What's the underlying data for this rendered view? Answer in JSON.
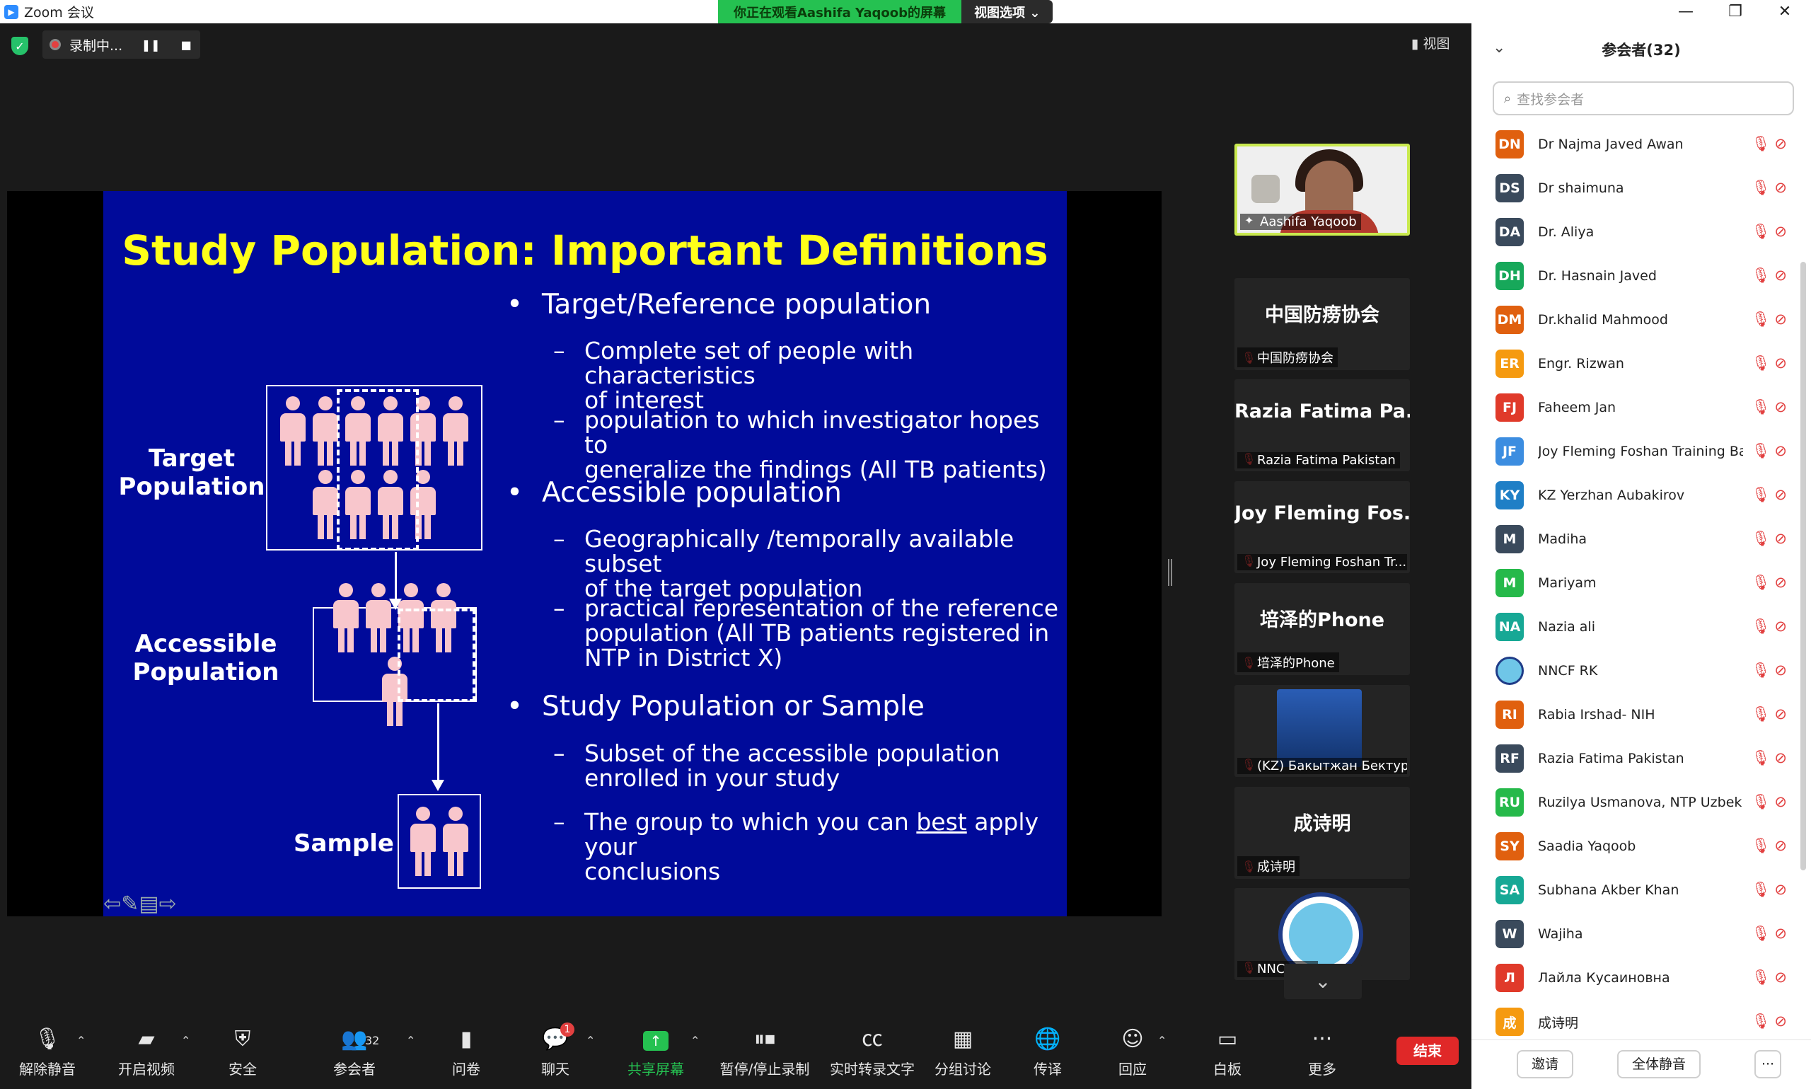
{
  "window": {
    "app_title": "Zoom 会议",
    "watching_banner": "你正在观看Aashifa Yaqoob的屏幕",
    "view_options": "视图选项 ⌄",
    "minimize": "—",
    "restore": "❐",
    "close": "✕"
  },
  "meeting": {
    "recording_label": "录制中...",
    "pause_glyph": "❚❚",
    "stop_glyph": "■",
    "view_button": "▮ 视图"
  },
  "slide": {
    "title": "Study Population: Important Definitions",
    "bullets": [
      {
        "text": "Target/Reference population",
        "subs": [
          "Complete set of people with characteristics of interest",
          "population to which investigator hopes to generalize the findings (All TB patients)"
        ]
      },
      {
        "text": "Accessible population",
        "subs": [
          "Geographically /temporally available subset of the target population",
          "practical representation of the reference population (All TB patients registered in NTP in District X)"
        ]
      },
      {
        "text": "Study Population or Sample",
        "subs": [
          "Subset of the accessible population enrolled in your study",
          "The group to which you can best apply your conclusions"
        ]
      }
    ],
    "sub_lines": {
      "b1s1": [
        "Complete set of people with characteristics",
        "of interest"
      ],
      "b1s2": [
        "population to which investigator hopes to",
        "generalize the findings (All TB patients)"
      ],
      "b2s1": [
        "Geographically /temporally available subset",
        "of the target population"
      ],
      "b2s2": [
        "practical representation of the reference",
        "population (All TB patients registered in",
        "NTP in District X)"
      ],
      "b3s1": [
        "Subset of the accessible population",
        "enrolled in your study"
      ],
      "b3s2_pre": "The group to which you can ",
      "b3s2_underlined": "best",
      "b3s2_post": " apply your",
      "b3s2_line2": "conclusions"
    },
    "diagram": {
      "target_label": [
        "Target",
        "Population"
      ],
      "accessible_label": [
        "Accessible",
        "Population"
      ],
      "sample_label": "Sample"
    },
    "bullet_glyph": "•",
    "dash_glyph": "–",
    "nav_glyphs": "⇦✎▤⇨"
  },
  "thumbnails": [
    {
      "big": "",
      "tag": "Aashifa Yaqoob",
      "type": "video"
    },
    {
      "big": "中国防痨协会",
      "tag": "中国防痨协会"
    },
    {
      "big": "Razia Fatima Pa...",
      "tag": "Razia Fatima Pakistan"
    },
    {
      "big": "Joy Fleming Fos...",
      "tag": "Joy Fleming Foshan Tr..."
    },
    {
      "big": "培泽的Phone",
      "tag": "培泽的Phone"
    },
    {
      "big": "",
      "tag": "(KZ) Бакытжан Бектур...",
      "type": "photo"
    },
    {
      "big": "成诗明",
      "tag": "成诗明"
    },
    {
      "big": "",
      "tag": "NNCF RK",
      "type": "logo"
    }
  ],
  "toolbar": {
    "unmute": "解除静音",
    "start_video": "开启视频",
    "security": "安全",
    "participants": "参会者",
    "participants_count": "32",
    "polls": "问卷",
    "chat": "聊天",
    "chat_badge": "1",
    "share": "共享屏幕",
    "pause_record": "暂停/停止录制",
    "captions": "实时转录文字",
    "breakout": "分组讨论",
    "interpretation": "传译",
    "reactions": "回应",
    "whiteboard": "白板",
    "more": "更多",
    "end": "结束"
  },
  "panel": {
    "title": "参会者(32)",
    "search_placeholder": "查找参会者",
    "participants": [
      {
        "initials": "DN",
        "name": "Dr Najma Javed Awan",
        "color": "#e0600f"
      },
      {
        "initials": "DS",
        "name": "Dr shaimuna",
        "color": "#3a4a5c"
      },
      {
        "initials": "DA",
        "name": "Dr. Aliya",
        "color": "#3a4a5c"
      },
      {
        "initials": "DH",
        "name": "Dr. Hasnain Javed",
        "color": "#17a85a"
      },
      {
        "initials": "DM",
        "name": "Dr.khalid Mahmood",
        "color": "#e0600f"
      },
      {
        "initials": "ER",
        "name": "Engr. Rizwan",
        "color": "#f59a10"
      },
      {
        "initials": "FJ",
        "name": "Faheem Jan",
        "color": "#e03a2a"
      },
      {
        "initials": "JF",
        "name": "Joy Fleming Foshan Training Ba...",
        "color": "#3c8de0"
      },
      {
        "initials": "KY",
        "name": "KZ Yerzhan Aubakirov",
        "color": "#1f7fc6"
      },
      {
        "initials": "M",
        "name": "Madiha",
        "color": "#3a4a5c"
      },
      {
        "initials": "M",
        "name": "Mariyam",
        "color": "#26b94a"
      },
      {
        "initials": "NA",
        "name": "Nazia ali",
        "color": "#17a895"
      },
      {
        "initials": "",
        "name": "NNCF RK",
        "color": "#6fc6e8"
      },
      {
        "initials": "RI",
        "name": "Rabia Irshad- NIH",
        "color": "#e0600f"
      },
      {
        "initials": "RF",
        "name": "Razia Fatima Pakistan",
        "color": "#3a4a5c"
      },
      {
        "initials": "RU",
        "name": "Ruzilya Usmanova, NTP Uzbeki...",
        "color": "#26b94a"
      },
      {
        "initials": "SY",
        "name": "Saadia Yaqoob",
        "color": "#e0600f"
      },
      {
        "initials": "SA",
        "name": "Subhana Akber Khan",
        "color": "#17a895"
      },
      {
        "initials": "W",
        "name": "Wajiha",
        "color": "#3a4a5c"
      },
      {
        "initials": "Л",
        "name": "Лайла Кусаиновна",
        "color": "#e03a2a"
      },
      {
        "initials": "成",
        "name": "成诗明",
        "color": "#f59a10"
      }
    ],
    "invite": "邀请",
    "mute_all": "全体静音",
    "more": "···"
  }
}
